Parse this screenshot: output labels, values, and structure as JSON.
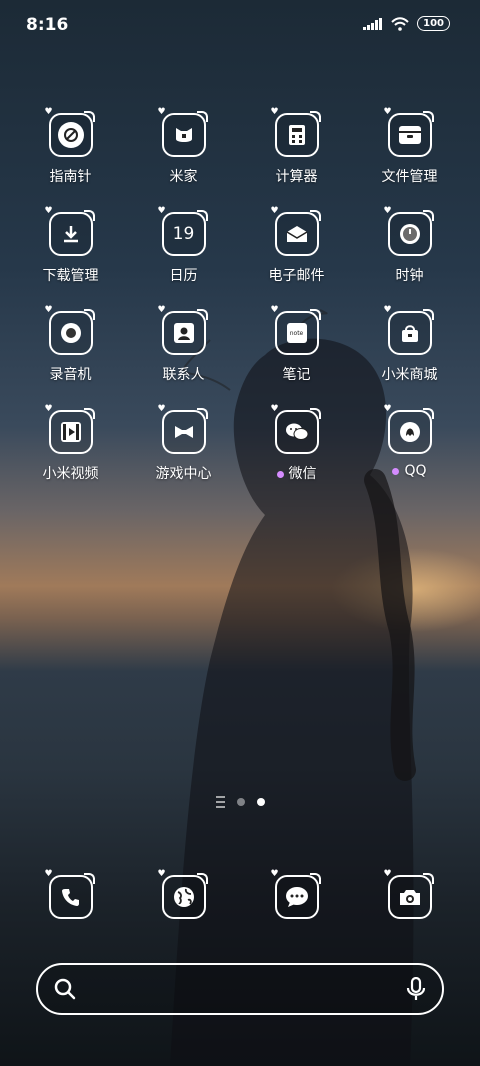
{
  "status": {
    "time": "8:16",
    "battery": "100"
  },
  "apps": [
    {
      "label": "指南针",
      "icon": "compass-icon"
    },
    {
      "label": "米家",
      "icon": "mijia-icon"
    },
    {
      "label": "计算器",
      "icon": "calculator-icon"
    },
    {
      "label": "文件管理",
      "icon": "folder-icon"
    },
    {
      "label": "下载管理",
      "icon": "download-icon"
    },
    {
      "label": "日历",
      "icon": "calendar-icon",
      "glyph": "19"
    },
    {
      "label": "电子邮件",
      "icon": "mail-icon"
    },
    {
      "label": "时钟",
      "icon": "clock-icon"
    },
    {
      "label": "录音机",
      "icon": "recorder-icon"
    },
    {
      "label": "联系人",
      "icon": "contacts-icon"
    },
    {
      "label": "笔记",
      "icon": "notes-icon",
      "glyph": "note"
    },
    {
      "label": "小米商城",
      "icon": "shopping-bag-icon"
    },
    {
      "label": "小米视频",
      "icon": "video-icon"
    },
    {
      "label": "游戏中心",
      "icon": "game-icon"
    },
    {
      "label": "微信",
      "icon": "wechat-icon",
      "badge": true
    },
    {
      "label": "QQ",
      "icon": "qq-icon",
      "badge": true
    }
  ],
  "dock": [
    {
      "icon": "phone-icon"
    },
    {
      "icon": "browser-icon"
    },
    {
      "icon": "messages-icon"
    },
    {
      "icon": "camera-icon"
    }
  ],
  "colors": {
    "badge": "#d58cff"
  }
}
